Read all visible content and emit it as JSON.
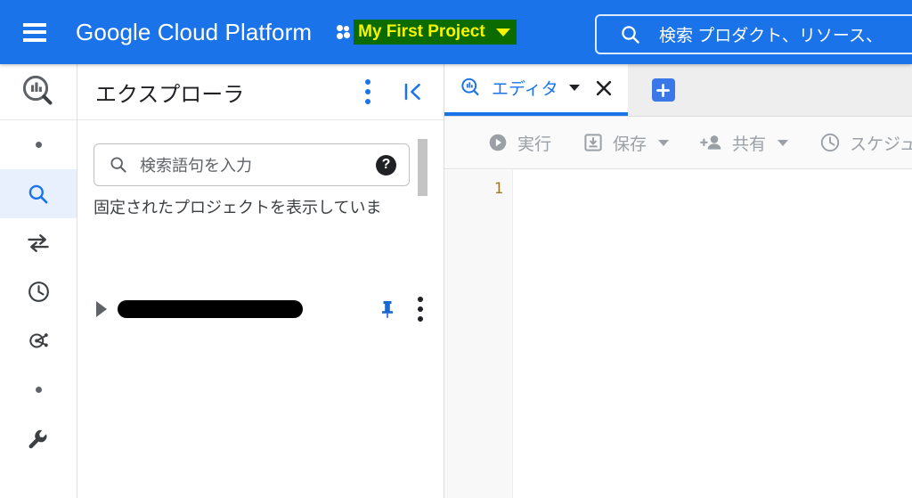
{
  "header": {
    "menu_icon": "hamburger-menu-icon",
    "brand": "Google Cloud Platform",
    "project_icon": "project-dots-icon",
    "project_name": "My First Project",
    "project_caret_icon": "chevron-down-icon",
    "search_icon": "search-icon",
    "search_placeholder": "検索  プロダクト、リソース、",
    "bg_color": "#1a73e8",
    "project_highlight_bg": "#0b6b00",
    "project_highlight_fg": "#f5f500"
  },
  "rail": {
    "logo_icon": "bigquery-logo-icon",
    "items": [
      {
        "icon": "dot-icon",
        "label": "",
        "active": false
      },
      {
        "icon": "search-icon",
        "label": "",
        "active": true
      },
      {
        "icon": "transfer-arrows-icon",
        "label": "",
        "active": false
      },
      {
        "icon": "clock-icon",
        "label": "",
        "active": false
      },
      {
        "icon": "scheduled-queries-icon",
        "label": "",
        "active": false
      },
      {
        "icon": "dot-icon",
        "label": "",
        "active": false
      },
      {
        "icon": "wrench-icon",
        "label": "",
        "active": false
      }
    ],
    "active_bg": "#e8f0fe",
    "active_fg": "#1a73e8"
  },
  "explorer": {
    "title": "エクスプローラ",
    "kebab_icon": "more-vert-icon",
    "collapse_icon": "collapse-panel-icon",
    "search_icon": "search-icon",
    "search_placeholder": "検索語句を入力",
    "help_icon": "help-icon",
    "pinned_note": "固定されたプロジェクトを表示していま",
    "expander_icon": "chevron-right-icon",
    "project_name": "",
    "pin_icon": "pin-icon",
    "row_kebab_icon": "more-vert-icon",
    "scrollbar": "vertical-scrollbar"
  },
  "editor": {
    "tab": {
      "icon": "bigquery-logo-icon",
      "label": "エディタ",
      "caret_icon": "chevron-down-icon",
      "close_icon": "close-icon",
      "active_color": "#1a73e8"
    },
    "add_tab_icon": "plus-icon",
    "toolbar": [
      {
        "icon": "play-circle-icon",
        "label": "実行",
        "caret": false
      },
      {
        "icon": "save-icon",
        "label": "保存",
        "caret": true
      },
      {
        "icon": "person-add-icon",
        "label": "共有",
        "caret": true
      },
      {
        "icon": "clock-icon",
        "label": "スケジュー",
        "caret": false
      }
    ],
    "line_numbers": [
      "1"
    ],
    "code_lines": [
      ""
    ]
  }
}
